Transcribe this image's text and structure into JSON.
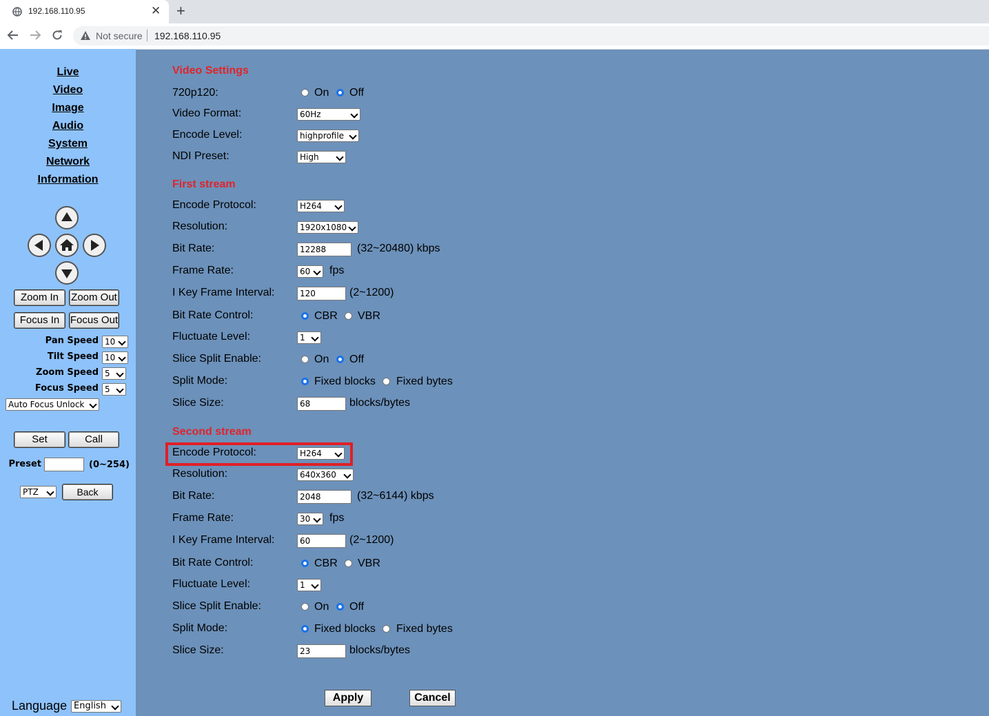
{
  "browser": {
    "tab_title": "192.168.110.95",
    "security_label": "Not secure",
    "url": "192.168.110.95"
  },
  "sidebar": {
    "nav": [
      "Live",
      "Video",
      "Image",
      "Audio",
      "System",
      "Network",
      "Information"
    ],
    "zoom_in": "Zoom In",
    "zoom_out": "Zoom Out",
    "focus_in": "Focus In",
    "focus_out": "Focus Out",
    "pan_speed_label": "Pan Speed",
    "pan_speed": "10",
    "tilt_speed_label": "Tilt Speed",
    "tilt_speed": "10",
    "zoom_speed_label": "Zoom Speed",
    "zoom_speed": "5",
    "focus_speed_label": "Focus Speed",
    "focus_speed": "5",
    "focus_mode": "Auto Focus Unlock",
    "set": "Set",
    "call": "Call",
    "preset_label": "Preset",
    "preset_value": "",
    "preset_range": "(0~254)",
    "mode": "PTZ",
    "back": "Back",
    "language_label": "Language",
    "language": "English"
  },
  "video_settings": {
    "title": "Video Settings",
    "p720p120_label": "720p120:",
    "on": "On",
    "off": "Off",
    "p720p120_value": "Off",
    "video_format_label": "Video Format:",
    "video_format": "60Hz",
    "encode_level_label": "Encode Level:",
    "encode_level": "highprofile",
    "ndi_preset_label": "NDI Preset:",
    "ndi_preset": "High"
  },
  "first_stream": {
    "title": "First stream",
    "encode_protocol_label": "Encode Protocol:",
    "encode_protocol": "H264",
    "resolution_label": "Resolution:",
    "resolution": "1920x1080",
    "bit_rate_label": "Bit Rate:",
    "bit_rate": "12288",
    "bit_rate_range": "(32~20480) kbps",
    "frame_rate_label": "Frame Rate:",
    "frame_rate": "60",
    "fps": "fps",
    "key_frame_label": "I Key Frame Interval:",
    "key_frame": "120",
    "key_frame_range": "(2~1200)",
    "bit_rate_control_label": "Bit Rate Control:",
    "cbr": "CBR",
    "vbr": "VBR",
    "bit_rate_control": "CBR",
    "fluctuate_label": "Fluctuate Level:",
    "fluctuate": "1",
    "slice_split_label": "Slice Split Enable:",
    "slice_split": "Off",
    "split_mode_label": "Split Mode:",
    "fixed_blocks": "Fixed blocks",
    "fixed_bytes": "Fixed bytes",
    "split_mode": "Fixed blocks",
    "slice_size_label": "Slice Size:",
    "slice_size": "68",
    "slice_size_unit": "blocks/bytes"
  },
  "second_stream": {
    "title": "Second stream",
    "encode_protocol_label": "Encode Protocol:",
    "encode_protocol": "H264",
    "resolution_label": "Resolution:",
    "resolution": "640x360",
    "bit_rate_label": "Bit Rate:",
    "bit_rate": "2048",
    "bit_rate_range": "(32~6144) kbps",
    "frame_rate_label": "Frame Rate:",
    "frame_rate": "30",
    "fps": "fps",
    "key_frame_label": "I Key Frame Interval:",
    "key_frame": "60",
    "key_frame_range": "(2~1200)",
    "bit_rate_control_label": "Bit Rate Control:",
    "cbr": "CBR",
    "vbr": "VBR",
    "bit_rate_control": "CBR",
    "fluctuate_label": "Fluctuate Level:",
    "fluctuate": "1",
    "slice_split_label": "Slice Split Enable:",
    "slice_split": "Off",
    "split_mode_label": "Split Mode:",
    "fixed_blocks": "Fixed blocks",
    "fixed_bytes": "Fixed bytes",
    "split_mode": "Fixed blocks",
    "slice_size_label": "Slice Size:",
    "slice_size": "23",
    "slice_size_unit": "blocks/bytes"
  },
  "actions": {
    "apply": "Apply",
    "cancel": "Cancel"
  },
  "colors": {
    "section_title": "#e0242b",
    "main_bg": "#6c91ba",
    "sidebar_bg": "#8ec2fa",
    "highlight": "#e01f26",
    "radio_selected": "#1a73e8"
  }
}
